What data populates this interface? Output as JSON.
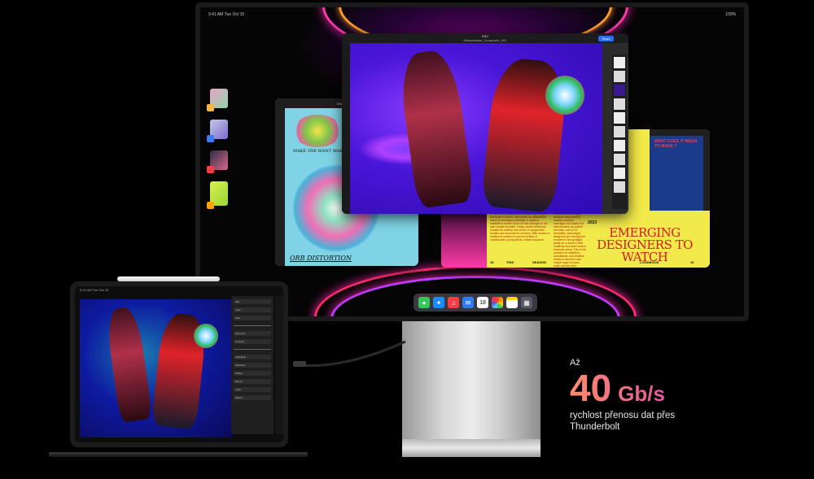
{
  "monitor": {
    "status_time": "9:41 AM   Tue Oct 15",
    "status_right": "100%",
    "windows": {
      "left": {
        "title": "Orb Distortion",
        "caption_top": "MAKE THE WANT MAKE SENSE",
        "caption_bottom": "ORB DISTORTION"
      },
      "main": {
        "title": "DSC",
        "document": "Manipulation_Composite_001",
        "share_label": "Share"
      },
      "magazine": {
        "side_header": "WHAT DOES IT MEAN TO MAKE ?",
        "year": "2023",
        "title": "EMERGING DESIGNERS TO WATCH",
        "footer_left": "18",
        "footer_mid1": "THIS",
        "footer_mid2": "SEASON",
        "footer_right_label": "LOOKBOOK",
        "footer_right_num": "19",
        "col1": "In the not too distant past, an aspiring designer would go to school, train under an established brand or leverage a celebrity or stylist to establish a career. But a lot has changed in the past couple decades. Today, social media has created an entirely new world of unexpected hurdles and avenues for success. With access to traditional models of success limited or unattainable, young artists, critical exposure",
        "col2": "can send an emerging designer skyrocketing towards success overnight. All it takes is a viral moment, an ardent fan base, and a DIY sensibility; well-taught designers are having their moment in the spotlight, pretty as a result of their creativity and best modern business savvy. This is the moment for outsiders, autodidacts, and creative rebels to find their own unique ways to make noise and be seen."
      }
    },
    "dock_icons": [
      "messages-icon",
      "safari-icon",
      "music-icon",
      "mail-icon",
      "calendar-icon",
      "photos-icon",
      "notes-icon",
      "app-library-icon"
    ],
    "dock_calendar_day": "18"
  },
  "ipad": {
    "status_time": "9:41 AM   Tue Oct 15",
    "panel_rows": [
      "Edit",
      "Light",
      "Auto",
      "Exposure",
      "Contrast",
      "Highlights",
      "Shadows",
      "Whites",
      "Blacks",
      "Color",
      "Effects"
    ]
  },
  "specs": {
    "prefix": "Až",
    "number": "40",
    "unit": "Gb/s",
    "caption_line1": "rychlost přenosu dat přes",
    "caption_line2": "Thunderbolt"
  },
  "colors": {
    "gradient_start": "#ff8a6a",
    "gradient_mid": "#e25b9c",
    "gradient_end": "#b34ff0"
  }
}
